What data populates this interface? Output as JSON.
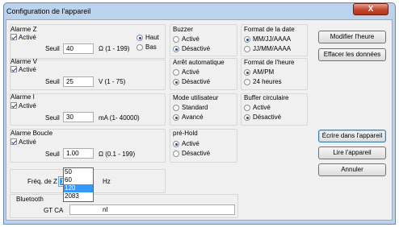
{
  "window": {
    "title": "Configuration de l'appareil",
    "close_glyph": "X"
  },
  "alarme_z": {
    "title": "Alarme Z",
    "active": "Activé",
    "seuil_label": "Seuil",
    "seuil_value": "40",
    "range": "Ω (1 - 199)",
    "haut": "Haut",
    "bas": "Bas"
  },
  "alarme_v": {
    "title": "Alarme V",
    "active": "Activé",
    "seuil_label": "Seuil",
    "seuil_value": "25",
    "range": "V (1 - 75)"
  },
  "alarme_i": {
    "title": "Alarme I",
    "active": "Activé",
    "seuil_label": "Seuil",
    "seuil_value": "30",
    "range": "mA (1- 40000)"
  },
  "alarme_boucle": {
    "title": "Alarme Boucle",
    "active": "Activé",
    "seuil_label": "Seuil",
    "seuil_value": "1.00",
    "range": "Ω (0.1 - 199)"
  },
  "buzzer": {
    "title": "Buzzer",
    "opt1": "Activé",
    "opt2": "Désactivé"
  },
  "arret": {
    "title": "Arrêt automatique",
    "opt1": "Activé",
    "opt2": "Désactivé"
  },
  "mode": {
    "title": "Mode utilisateur",
    "opt1": "Standard",
    "opt2": "Avancé"
  },
  "prehold": {
    "title": "pré-Hold",
    "opt1": "Activé",
    "opt2": "Désactivé"
  },
  "date": {
    "title": "Format de la date",
    "opt1": "MM/JJ/AAAA",
    "opt2": "JJ/MM/AAAA"
  },
  "heure": {
    "title": "Format de l'heure",
    "opt1": "AM/PM",
    "opt2": "24 heures"
  },
  "buffer": {
    "title": "Buffer circulaire",
    "opt1": "Activé",
    "opt2": "Désactivé"
  },
  "buttons": {
    "modifier": "Modifier l'heure",
    "effacer": "Effacer les données",
    "ecrire": "Écrire dans l'appareil",
    "lire": "Lire l'appareil",
    "annuler": "Annuler"
  },
  "freq": {
    "label": "Fréq. de Z",
    "value": "120",
    "unit": "Hz",
    "options": [
      "50",
      "60",
      "120",
      "2083"
    ]
  },
  "bluetooth": {
    "title": "Bluetooth",
    "name_partial_left": "GT CA",
    "name_partial_right": "nl"
  }
}
